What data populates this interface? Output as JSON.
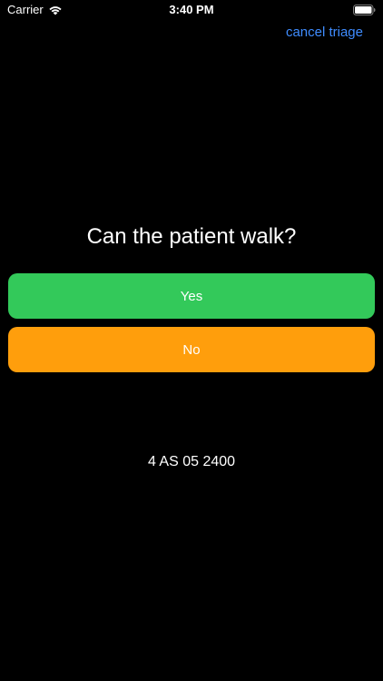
{
  "status_bar": {
    "carrier": "Carrier",
    "time": "3:40 PM",
    "wifi_icon": "wifi-icon",
    "battery_icon": "battery-icon"
  },
  "nav": {
    "cancel_label": "cancel triage",
    "link_color": "#3f8cff"
  },
  "question": {
    "text": "Can the patient walk?"
  },
  "answers": [
    {
      "label": "Yes",
      "color": "#33c95a"
    },
    {
      "label": "No",
      "color": "#ff9e0c"
    }
  ],
  "patient_code": "4 AS 05 2400"
}
